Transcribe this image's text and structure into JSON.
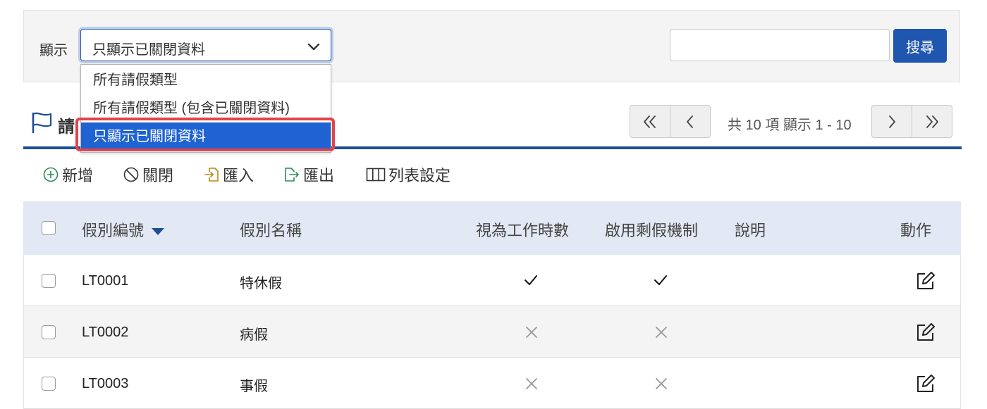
{
  "filter": {
    "label": "顯示",
    "selected": "只顯示已關閉資料",
    "options": [
      "所有請假類型",
      "所有請假類型 (包含已關閉資料)",
      "只顯示已關閉資料"
    ],
    "search_value": "",
    "search_button": "搜尋"
  },
  "section": {
    "title": "請"
  },
  "pager": {
    "info": "共 10 項 顯示 1 - 10"
  },
  "toolbar": {
    "add": "新增",
    "close": "關閉",
    "import": "匯入",
    "export": "匯出",
    "columns": "列表設定"
  },
  "table": {
    "columns": [
      "假別編號",
      "假別名稱",
      "視為工作時數",
      "啟用剩假機制",
      "說明",
      "動作"
    ],
    "rows": [
      {
        "code": "LT0001",
        "name": "特休假",
        "work_hours": true,
        "balance": true,
        "desc": ""
      },
      {
        "code": "LT0002",
        "name": "病假",
        "work_hours": false,
        "balance": false,
        "desc": ""
      },
      {
        "code": "LT0003",
        "name": "事假",
        "work_hours": false,
        "balance": false,
        "desc": ""
      }
    ]
  },
  "colors": {
    "primary": "#1f56b0",
    "selected_option": "#1f63d2",
    "highlight": "#e5434a",
    "header_bg": "#e3e9f4"
  }
}
